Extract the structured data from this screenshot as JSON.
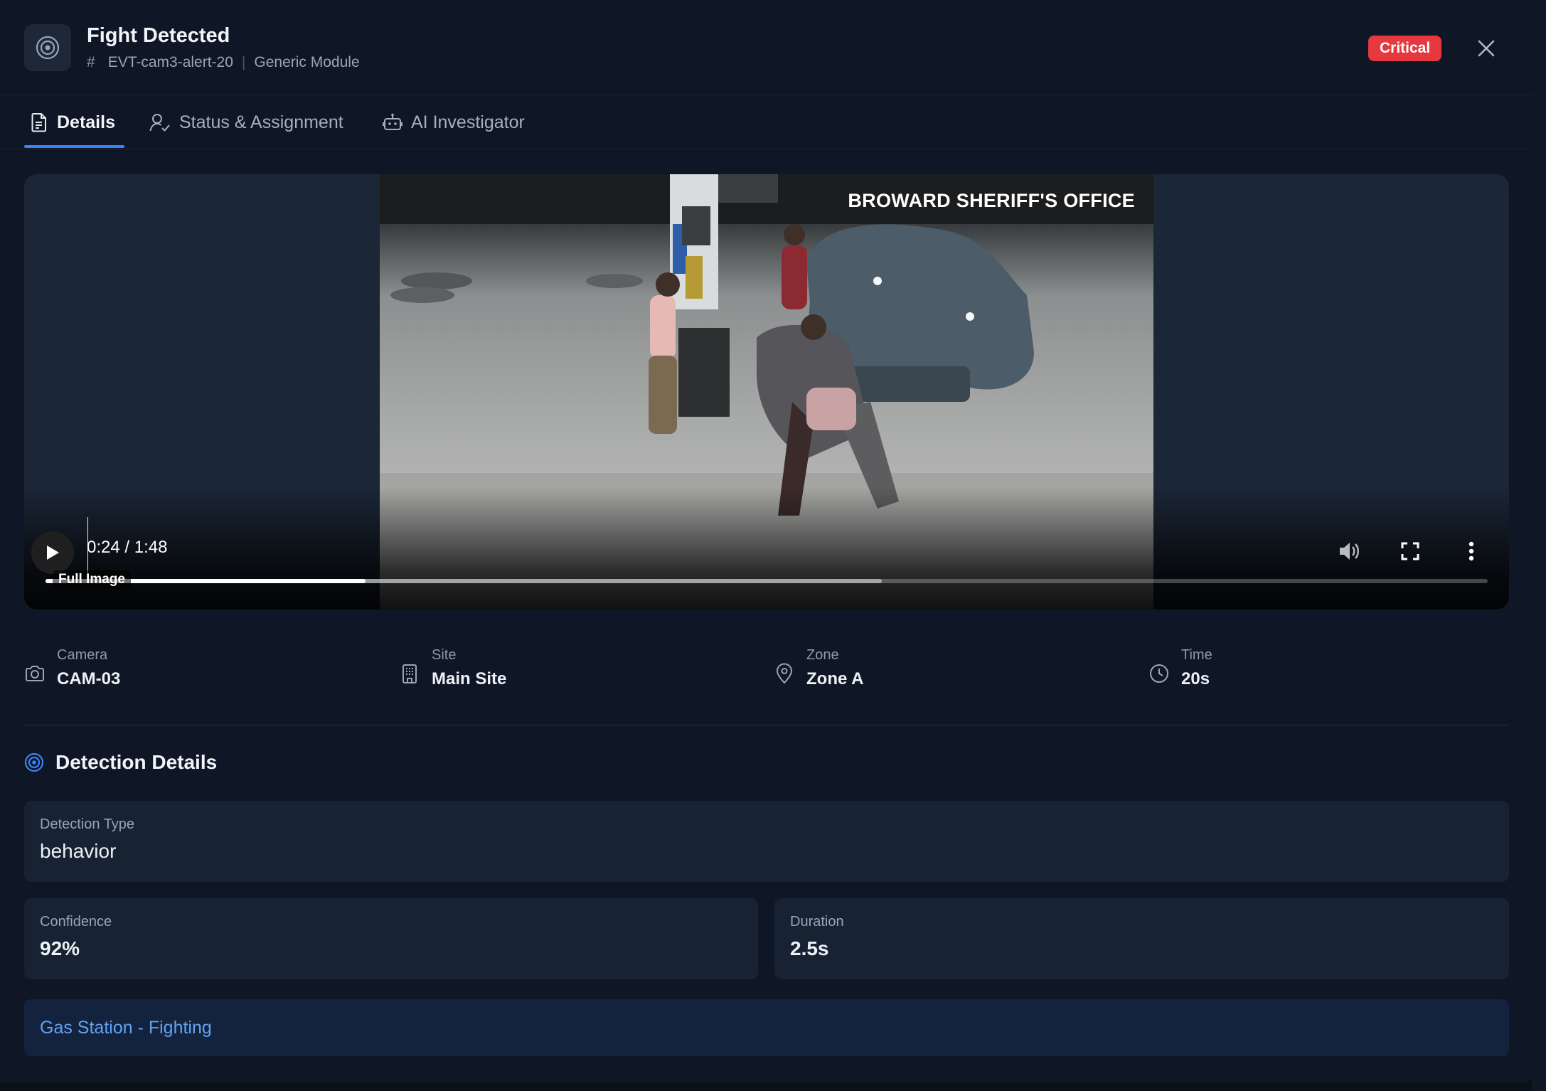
{
  "header": {
    "title": "Fight Detected",
    "event_id": "EVT-cam3-alert-20",
    "module": "Generic Module",
    "severity": "Critical",
    "icon": "target-icon"
  },
  "tabs": [
    {
      "label": "Details",
      "icon": "document-icon",
      "active": true
    },
    {
      "label": "Status & Assignment",
      "icon": "user-check-icon",
      "active": false
    },
    {
      "label": "AI Investigator",
      "icon": "robot-icon",
      "active": false
    }
  ],
  "video": {
    "watermark": "BROWARD SHERIFF'S OFFICE",
    "time": "0:24 / 1:48",
    "image_label": "Full Image",
    "progress_fraction": 0.222,
    "buffered_fraction": 0.58
  },
  "meta": {
    "camera": {
      "label": "Camera",
      "value": "CAM-03"
    },
    "site": {
      "label": "Site",
      "value": "Main Site"
    },
    "zone": {
      "label": "Zone",
      "value": "Zone A"
    },
    "time": {
      "label": "Time",
      "value": "20s"
    }
  },
  "detection": {
    "section_title": "Detection Details",
    "type_label": "Detection Type",
    "type_value": "behavior",
    "confidence_label": "Confidence",
    "confidence_value": "92%",
    "duration_label": "Duration",
    "duration_value": "2.5s",
    "tag": "Gas Station - Fighting"
  },
  "colors": {
    "accent": "#3b82f6",
    "critical": "#e5393f",
    "background": "#0f1726",
    "card": "#172233",
    "link": "#5fa3f2"
  }
}
